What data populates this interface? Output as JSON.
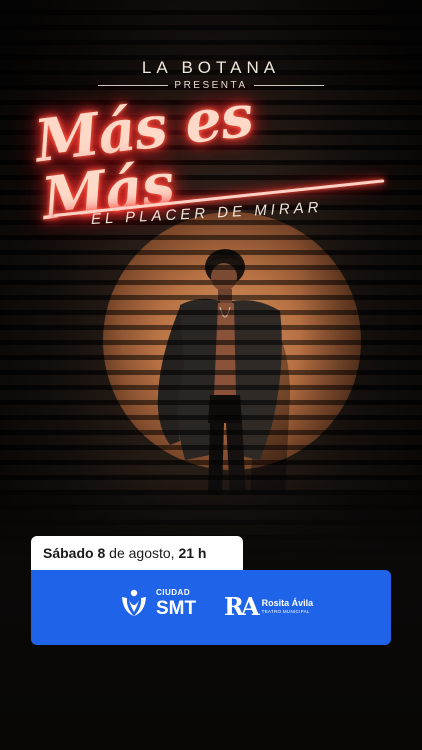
{
  "header": {
    "brand": "LA BOTANA",
    "presenta": "PRESENTA"
  },
  "title": "Más es Más",
  "subtitle": "EL PLACER DE MIRAR",
  "event": {
    "day": "Sábado",
    "date_number": "8",
    "date_rest": "de agosto,",
    "time": "21 h"
  },
  "sponsors": {
    "smt_small": "CIUDAD",
    "smt_big": "SMT",
    "ra_mark": "RA",
    "ra_name": "Rosita Ávila",
    "ra_sub": "TEATRO MUNICIPAL"
  },
  "colors": {
    "sponsor_bar": "#1f63e8",
    "neon": "#ff3b2f"
  }
}
